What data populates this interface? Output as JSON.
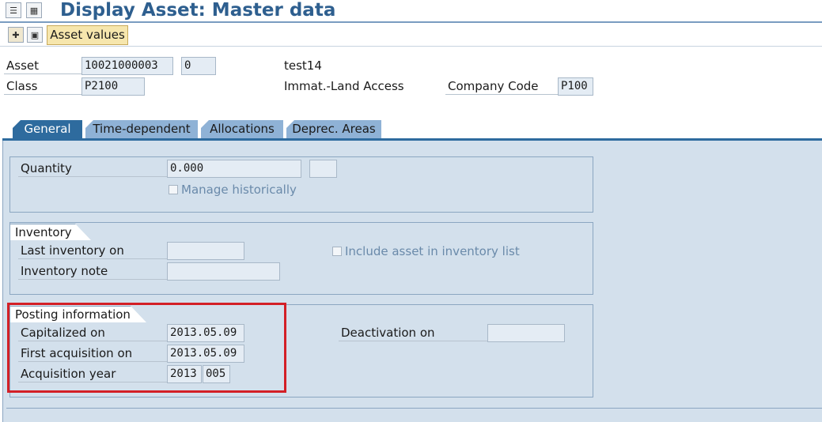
{
  "window": {
    "title": "Display Asset:  Master data"
  },
  "toolbar": {
    "asset_values_label": "Asset values"
  },
  "header": {
    "asset_label": "Asset",
    "asset_number": "10021000003",
    "asset_subnumber": "0",
    "asset_description": "test14",
    "class_label": "Class",
    "class_value": "P2100",
    "class_description": "Immat.-Land Access",
    "company_code_label": "Company Code",
    "company_code_value": "P100"
  },
  "tabs": [
    {
      "label": "General",
      "active": true
    },
    {
      "label": "Time-dependent",
      "active": false
    },
    {
      "label": "Allocations",
      "active": false
    },
    {
      "label": "Deprec. Areas",
      "active": false
    }
  ],
  "quantity": {
    "label": "Quantity",
    "value": "0.000",
    "unit": "",
    "manage_historically_label": "Manage historically"
  },
  "inventory": {
    "title": "Inventory",
    "last_inventory_label": "Last inventory on",
    "last_inventory_value": "",
    "inventory_note_label": "Inventory note",
    "inventory_note_value": "",
    "include_label": "Include asset in inventory list"
  },
  "posting": {
    "title": "Posting information",
    "capitalized_label": "Capitalized on",
    "capitalized_value": "2013.05.09",
    "first_acq_label": "First acquisition on",
    "first_acq_value": "2013.05.09",
    "acq_year_label": "Acquisition year",
    "acq_year_value": "2013",
    "acq_period_value": "005",
    "deactivation_label": "Deactivation on",
    "deactivation_value": ""
  },
  "colors": {
    "title": "#2e5f8f",
    "tab_active": "#2e6b9e",
    "tab_inactive": "#8fb2d6",
    "panel": "#d3e0ec",
    "highlight": "#d31f26"
  }
}
